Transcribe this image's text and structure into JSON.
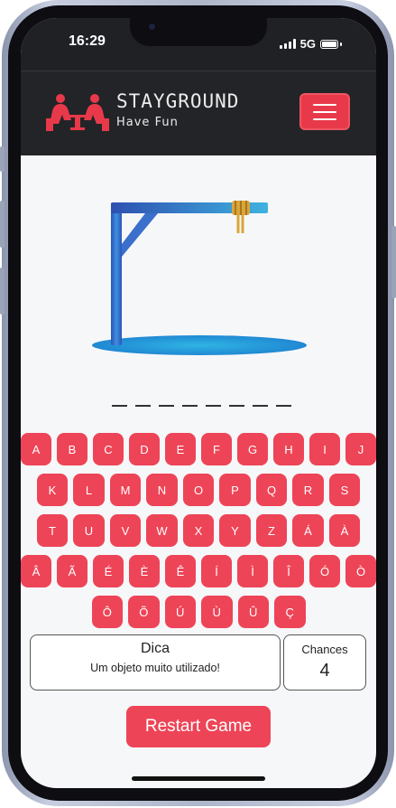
{
  "status": {
    "time": "16:29",
    "network": "5G"
  },
  "brand": {
    "name": "STAYGROUND",
    "tagline": "Have Fun",
    "accent": "#e8394a"
  },
  "game": {
    "word_length": 8,
    "keyboard": [
      [
        "A",
        "B",
        "C",
        "D",
        "E",
        "F",
        "G",
        "H",
        "I",
        "J"
      ],
      [
        "K",
        "L",
        "M",
        "N",
        "O",
        "P",
        "Q",
        "R",
        "S"
      ],
      [
        "T",
        "U",
        "V",
        "W",
        "X",
        "Y",
        "Z",
        "Á",
        "À"
      ],
      [
        "Â",
        "Ã",
        "É",
        "È",
        "Ê",
        "Í",
        "Ì",
        "Î",
        "Ó",
        "Ò"
      ],
      [
        "Ô",
        "Õ",
        "Ú",
        "Ù",
        "Û",
        "Ç"
      ]
    ],
    "hint_title": "Dica",
    "hint_text": "Um objeto muito utilizado!",
    "chances_label": "Chances",
    "chances_value": "4",
    "restart_label": "Restart Game",
    "key_color": "#ee4457"
  }
}
